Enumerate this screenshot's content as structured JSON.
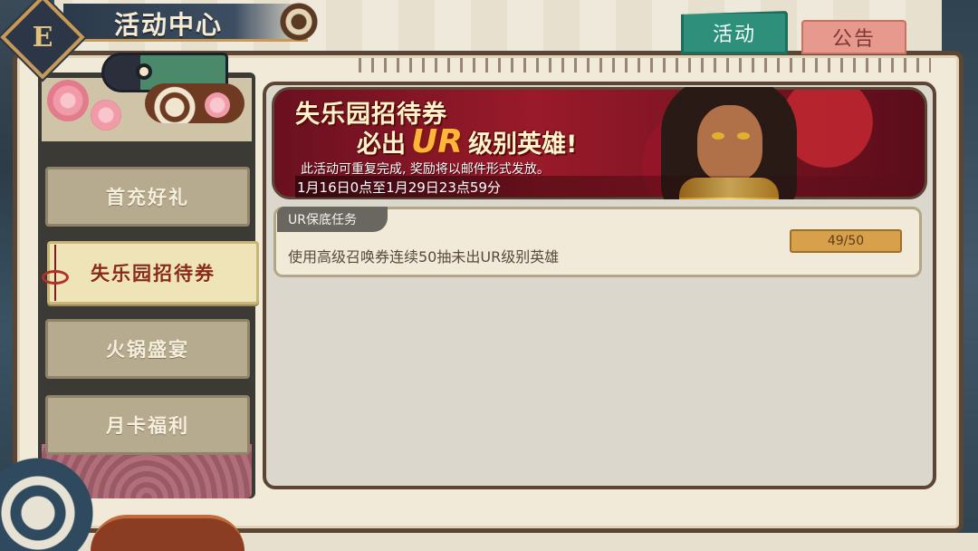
{
  "header": {
    "logo_glyph": "E",
    "title": "活动中心"
  },
  "tabs": [
    {
      "label": "活动",
      "active": true
    },
    {
      "label": "公告",
      "active": false
    }
  ],
  "sidebar": {
    "items": [
      {
        "label": "首充好礼",
        "active": false
      },
      {
        "label": "失乐园招待券",
        "active": true
      },
      {
        "label": "火锅盛宴",
        "active": false
      },
      {
        "label": "月卡福利",
        "active": false
      }
    ]
  },
  "banner": {
    "title_line1": "失乐园招待券",
    "title_line2_prefix": "必出",
    "title_line2_highlight": "UR",
    "title_line2_suffix": "级别英雄!",
    "description": "此活动可重复完成, 奖励将以邮件形式发放。",
    "date_range": "1月16日0点至1月29日23点59分"
  },
  "task": {
    "label": "UR保底任务",
    "description": "使用高级召唤券连续50抽未出UR级别英雄",
    "progress_text": "49/50"
  },
  "colors": {
    "active_tab": "#2e8f7a",
    "inactive_tab": "#e7998d",
    "frame": "#5b4535",
    "progress": "#d8a04a"
  }
}
